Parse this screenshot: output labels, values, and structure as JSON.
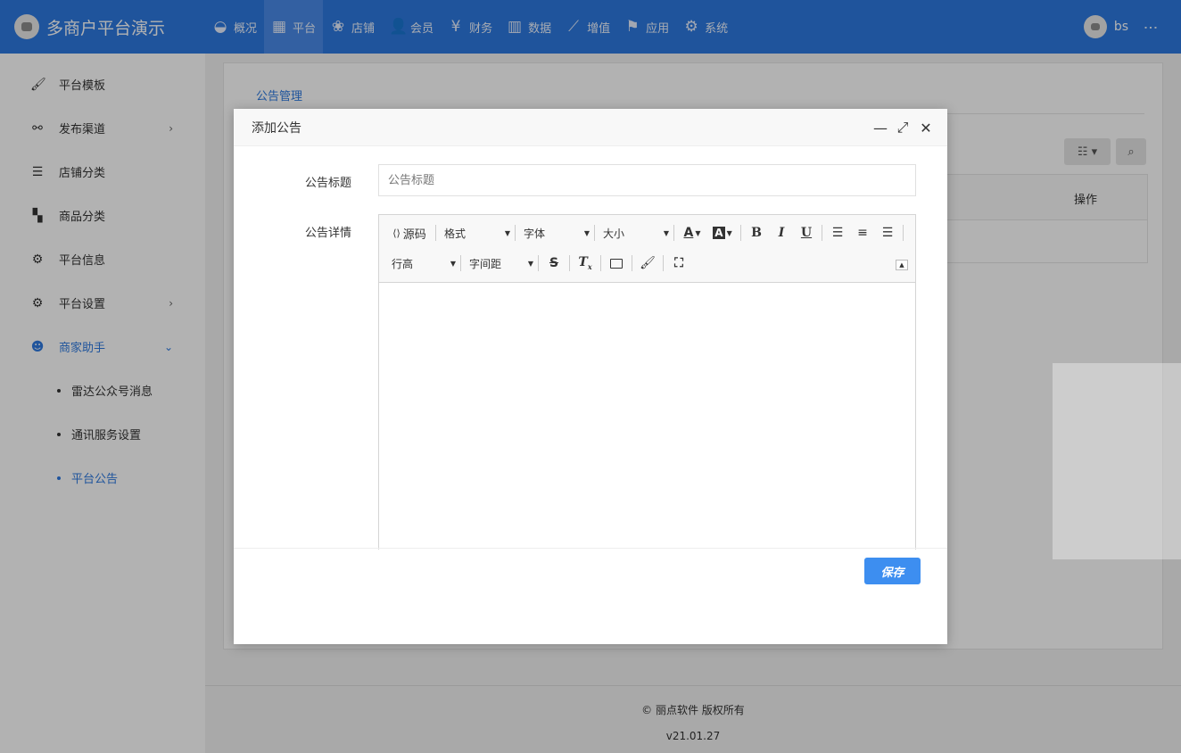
{
  "brand": {
    "title": "多商户平台演示"
  },
  "nav": [
    {
      "label": "概况",
      "icon": "dashboard-icon",
      "glyph": "◒"
    },
    {
      "label": "平台",
      "icon": "grid-icon",
      "glyph": "▦",
      "active": true
    },
    {
      "label": "店铺",
      "icon": "paw-icon",
      "glyph": "❀"
    },
    {
      "label": "会员",
      "icon": "user-plus-icon",
      "glyph": "👤"
    },
    {
      "label": "财务",
      "icon": "yen-icon",
      "glyph": "¥"
    },
    {
      "label": "数据",
      "icon": "bar-chart-icon",
      "glyph": "▥"
    },
    {
      "label": "增值",
      "icon": "line-chart-icon",
      "glyph": "⟋"
    },
    {
      "label": "应用",
      "icon": "flag-icon",
      "glyph": "⚑"
    },
    {
      "label": "系统",
      "icon": "gear-icon",
      "glyph": "⚙"
    }
  ],
  "user": {
    "name": "bs",
    "more": "⋮"
  },
  "sidebar": {
    "items": [
      {
        "label": "平台模板",
        "icon": "paint-roller-icon",
        "glyph": "🖌",
        "arrow": ""
      },
      {
        "label": "发布渠道",
        "icon": "link-icon",
        "glyph": "⚯",
        "arrow": "›"
      },
      {
        "label": "店铺分类",
        "icon": "list-icon",
        "glyph": "☰",
        "arrow": ""
      },
      {
        "label": "商品分类",
        "icon": "apps-icon",
        "glyph": "▚",
        "arrow": ""
      },
      {
        "label": "平台信息",
        "icon": "gear-icon",
        "glyph": "⚙",
        "arrow": ""
      },
      {
        "label": "平台设置",
        "icon": "gear-icon",
        "glyph": "⚙",
        "arrow": "›"
      },
      {
        "label": "商家助手",
        "icon": "smile-icon",
        "glyph": "☻",
        "arrow": "⌄"
      }
    ],
    "subitems": [
      {
        "label": "雷达公众号消息"
      },
      {
        "label": "通讯服务设置"
      },
      {
        "label": "平台公告"
      }
    ]
  },
  "main": {
    "title": "公告管理",
    "table": {
      "col_action": "操作"
    }
  },
  "footer": {
    "copyright": "© 丽点软件 版权所有",
    "version": "v21.01.27"
  },
  "modal": {
    "title": "添加公告",
    "minimize": "—",
    "maximize": "⤢",
    "close": "✕",
    "title_label": "公告标题",
    "title_placeholder": "公告标题",
    "title_value": "",
    "detail_label": "公告详情",
    "save": "保存",
    "toolbar": {
      "source": "源码",
      "format": "格式",
      "font": "字体",
      "size": "大小",
      "line_height": "行高",
      "letter_spacing": "字间距"
    }
  }
}
